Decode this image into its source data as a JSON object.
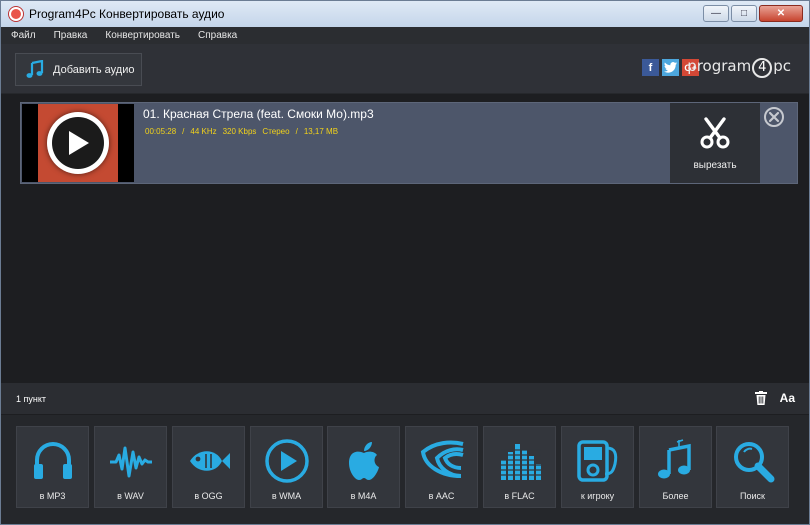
{
  "window": {
    "title": "Program4Pc Конвертировать аудио"
  },
  "menu": [
    "Файл",
    "Правка",
    "Конвертировать",
    "Справка"
  ],
  "toolbar": {
    "add_label": "Добавить аудио"
  },
  "brand": {
    "logo_pre": "program",
    "logo_digit": "4",
    "logo_post": "pc",
    "fb": "f",
    "gp": "G+"
  },
  "file": {
    "name": "01. Красная Стрела (feat. Смоки Мо).mp3",
    "duration": "00:05:28",
    "sep": "/",
    "rate": "44 KHz",
    "bitrate": "320 Kbps",
    "channels": "Стерео",
    "size": "13,17 MB",
    "cut_label": "вырезать"
  },
  "status": {
    "count": "1 пункт",
    "font_btn": "Aa"
  },
  "formats": [
    {
      "label": "в MP3",
      "icon": "headphones-icon"
    },
    {
      "label": "в WAV",
      "icon": "wave-icon"
    },
    {
      "label": "в OGG",
      "icon": "fish-icon"
    },
    {
      "label": "в WMA",
      "icon": "play-icon"
    },
    {
      "label": "в M4A",
      "icon": "apple-icon"
    },
    {
      "label": "в AAC",
      "icon": "signal-icon"
    },
    {
      "label": "в FLAC",
      "icon": "equalizer-icon"
    },
    {
      "label": "к игроку",
      "icon": "player-icon"
    },
    {
      "label": "Более",
      "icon": "music-note-icon"
    },
    {
      "label": "Поиск",
      "icon": "search-icon"
    }
  ],
  "colors": {
    "accent": "#29abe2",
    "meta": "#f2d21a",
    "row": "#4d566a"
  }
}
